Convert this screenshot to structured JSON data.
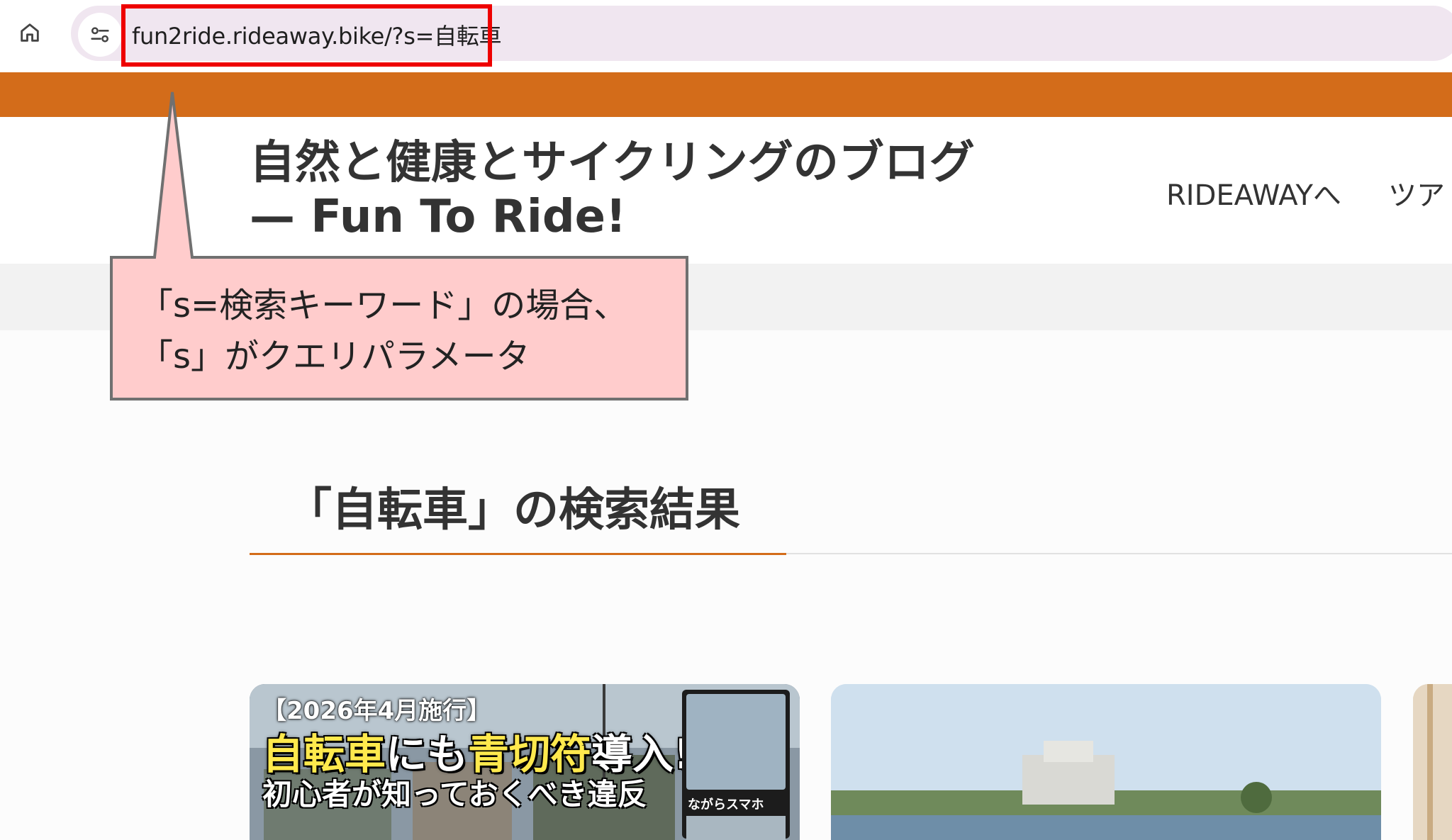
{
  "browser": {
    "url": "fun2ride.rideaway.bike/?s=自転車",
    "home_icon": "home-icon",
    "site_info_icon": "tune-icon",
    "highlight_color": "#ee0000"
  },
  "site": {
    "title": "自然と健康とサイクリングのブログ",
    "tagline": "— Fun To Ride!",
    "nav": [
      "RIDEAWAYへ",
      "ツア"
    ],
    "accent_color": "#d36c1a"
  },
  "callout": {
    "line1": "「s=検索キーワード」の場合、",
    "line2": "「s」がクエリパラメータ",
    "fill_color": "#ffcccc",
    "border_color": "#707070"
  },
  "search": {
    "heading": "「自転車」の検索結果"
  },
  "cards": [
    {
      "badge": "【2026年4月施行】",
      "headline_hl1": "自転車",
      "headline_mid1": "にも",
      "headline_hl2": "青切符",
      "headline_end": "導入!",
      "subline": "初心者が知っておくべき違反",
      "side_label": "ながらスマホ"
    },
    {},
    {}
  ]
}
